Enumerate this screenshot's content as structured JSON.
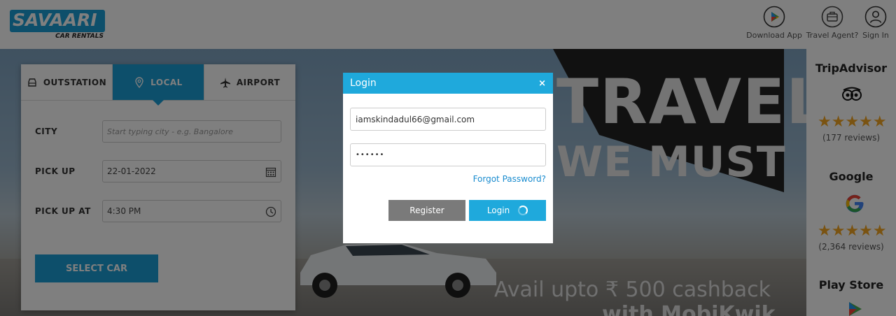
{
  "brand": {
    "name": "SAVAARI",
    "tagline": "CAR RENTALS",
    "color": "#1a9fd6"
  },
  "header": {
    "items": [
      {
        "label": "Download App",
        "icon": "play-store-icon"
      },
      {
        "label": "Travel Agent?",
        "icon": "briefcase-icon"
      },
      {
        "label": "Sign In",
        "icon": "user-icon"
      }
    ]
  },
  "booking": {
    "tabs": [
      {
        "label": "OUTSTATION",
        "icon": "car-front-icon",
        "active": false
      },
      {
        "label": "LOCAL",
        "icon": "location-pin-icon",
        "active": true
      },
      {
        "label": "AIRPORT",
        "icon": "airplane-icon",
        "active": false
      }
    ],
    "fields": {
      "city": {
        "label": "CITY",
        "placeholder": "Start typing city - e.g. Bangalore"
      },
      "pickup": {
        "label": "PICK UP",
        "value": "22-01-2022"
      },
      "pickup_at": {
        "label": "PICK UP AT",
        "value": "4:30 PM"
      }
    },
    "submit_label": "SELECT CAR"
  },
  "banner": {
    "line1": "TRAVEL",
    "line2": "WE MUST",
    "offer": "Avail upto ₹ 500 cashback",
    "offer2": "with MobiKwik"
  },
  "reviews": [
    {
      "title": "TripAdvisor",
      "count": "(177 reviews)",
      "rating": "5"
    },
    {
      "title": "Google",
      "count": "(2,364 reviews)",
      "rating": "4.5"
    },
    {
      "title": "Play Store"
    }
  ],
  "modal": {
    "title": "Login",
    "close": "×",
    "email": "iamskindadul66@gmail.com",
    "password": "••••••",
    "forgot": "Forgot Password?",
    "register_label": "Register",
    "login_label": "Login"
  },
  "colors": {
    "accent": "#1fa9dc",
    "register": "#7a7a7a",
    "star": "#f5a623"
  }
}
